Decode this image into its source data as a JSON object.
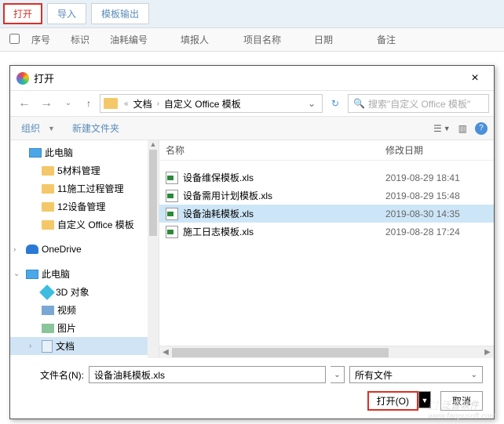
{
  "toolbar": {
    "open": "打开",
    "import": "导入",
    "template_export": "模板输出"
  },
  "columns": {
    "seq": "序号",
    "mark": "标识",
    "code": "油耗编号",
    "filler": "填报人",
    "project": "项目名称",
    "date": "日期",
    "remark": "备注"
  },
  "dialog": {
    "title": "打开",
    "path": {
      "seg1": "文档",
      "seg2": "自定义 Office 模板"
    },
    "search_placeholder": "搜索\"自定义 Office 模板\"",
    "organize": "组织",
    "new_folder": "新建文件夹",
    "tree": {
      "this_pc_top": "此电脑",
      "f1": "5材料管理",
      "f2": "11施工过程管理",
      "f3": "12设备管理",
      "f4": "自定义 Office 模板",
      "onedrive": "OneDrive",
      "this_pc": "此电脑",
      "obj3d": "3D 对象",
      "video": "视频",
      "pictures": "图片",
      "documents": "文档"
    },
    "file_headers": {
      "name": "名称",
      "date": "修改日期"
    },
    "files": [
      {
        "name": "设备维保模板.xls",
        "date": "2019-08-29 18:41"
      },
      {
        "name": "设备需用计划模板.xls",
        "date": "2019-08-29 15:48"
      },
      {
        "name": "设备油耗模板.xls",
        "date": "2019-08-30 14:35"
      },
      {
        "name": "施工日志模板.xls",
        "date": "2019-08-28 17:24"
      }
    ],
    "filename_label": "文件名(N):",
    "filename_value": "设备油耗模板.xls",
    "filter": "所有文件",
    "open_btn": "打开(O)",
    "cancel_btn": "取消"
  },
  "watermark": "泛普软件"
}
